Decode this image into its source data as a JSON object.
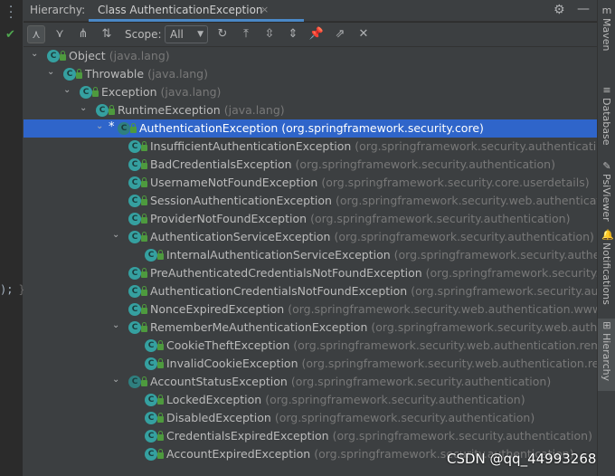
{
  "header": {
    "panel_label": "Hierarchy:",
    "tab_title": "Class AuthenticationException",
    "tab_close": "×"
  },
  "toolbar": {
    "scope_label": "Scope:",
    "scope_value": "All",
    "icons": [
      "subtypes-hierarchy-icon",
      "supertypes-hierarchy-icon",
      "class-hierarchy-icon",
      "sort-alpha-icon",
      "refresh-icon",
      "scroll-to-source-icon",
      "expand-all-icon",
      "collapse-all-icon",
      "pin-icon",
      "open-new-window-icon",
      "close-icon"
    ]
  },
  "editor_gutter": {
    "code_fragment": ");",
    "brace": "}"
  },
  "tree": [
    {
      "name": "Object",
      "pkg": "(java.lang)",
      "depth": 0,
      "expanded": true
    },
    {
      "name": "Throwable",
      "pkg": "(java.lang)",
      "depth": 1,
      "expanded": true
    },
    {
      "name": "Exception",
      "pkg": "(java.lang)",
      "depth": 2,
      "expanded": true
    },
    {
      "name": "RuntimeException",
      "pkg": "(java.lang)",
      "depth": 3,
      "expanded": true
    },
    {
      "name": "AuthenticationException",
      "pkg": "(org.springframework.security.core)",
      "depth": 4,
      "expanded": true,
      "selected": true,
      "star": true,
      "abstract": true
    },
    {
      "name": "InsufficientAuthenticationException",
      "pkg": "(org.springframework.security.authentication)",
      "depth": 5
    },
    {
      "name": "BadCredentialsException",
      "pkg": "(org.springframework.security.authentication)",
      "depth": 5
    },
    {
      "name": "UsernameNotFoundException",
      "pkg": "(org.springframework.security.core.userdetails)",
      "depth": 5
    },
    {
      "name": "SessionAuthenticationException",
      "pkg": "(org.springframework.security.web.authentication.se",
      "depth": 5
    },
    {
      "name": "ProviderNotFoundException",
      "pkg": "(org.springframework.security.authentication)",
      "depth": 5
    },
    {
      "name": "AuthenticationServiceException",
      "pkg": "(org.springframework.security.authentication)",
      "depth": 5,
      "expanded": true
    },
    {
      "name": "InternalAuthenticationServiceException",
      "pkg": "(org.springframework.security.authentica",
      "depth": 6
    },
    {
      "name": "PreAuthenticatedCredentialsNotFoundException",
      "pkg": "(org.springframework.security.web",
      "depth": 5
    },
    {
      "name": "AuthenticationCredentialsNotFoundException",
      "pkg": "(org.springframework.security.authen",
      "depth": 5
    },
    {
      "name": "NonceExpiredException",
      "pkg": "(org.springframework.security.web.authentication.www)",
      "depth": 5
    },
    {
      "name": "RememberMeAuthenticationException",
      "pkg": "(org.springframework.security.web.authentic",
      "depth": 5,
      "expanded": true
    },
    {
      "name": "CookieTheftException",
      "pkg": "(org.springframework.security.web.authentication.rememb",
      "depth": 6
    },
    {
      "name": "InvalidCookieException",
      "pkg": "(org.springframework.security.web.authentication.remem",
      "depth": 6
    },
    {
      "name": "AccountStatusException",
      "pkg": "(org.springframework.security.authentication)",
      "depth": 5,
      "expanded": true,
      "abstract": true
    },
    {
      "name": "LockedException",
      "pkg": "(org.springframework.security.authentication)",
      "depth": 6
    },
    {
      "name": "DisabledException",
      "pkg": "(org.springframework.security.authentication)",
      "depth": 6
    },
    {
      "name": "CredentialsExpiredException",
      "pkg": "(org.springframework.security.authentication)",
      "depth": 6
    },
    {
      "name": "AccountExpiredException",
      "pkg": "(org.springframework.security.authentication)",
      "depth": 6
    }
  ],
  "right_sidebar": [
    {
      "label": "Maven",
      "icon": "maven-icon",
      "glyph": "m"
    },
    {
      "label": "Database",
      "icon": "database-icon",
      "glyph": "≡"
    },
    {
      "label": "PsiViewer",
      "icon": "psiviewer-icon",
      "glyph": "✎"
    },
    {
      "label": "Notifications",
      "icon": "notifications-icon",
      "glyph": "🔔"
    },
    {
      "label": "Hierarchy",
      "icon": "hierarchy-icon",
      "glyph": "⊞",
      "active": true
    }
  ],
  "watermark": "CSDN @qq_44993268"
}
